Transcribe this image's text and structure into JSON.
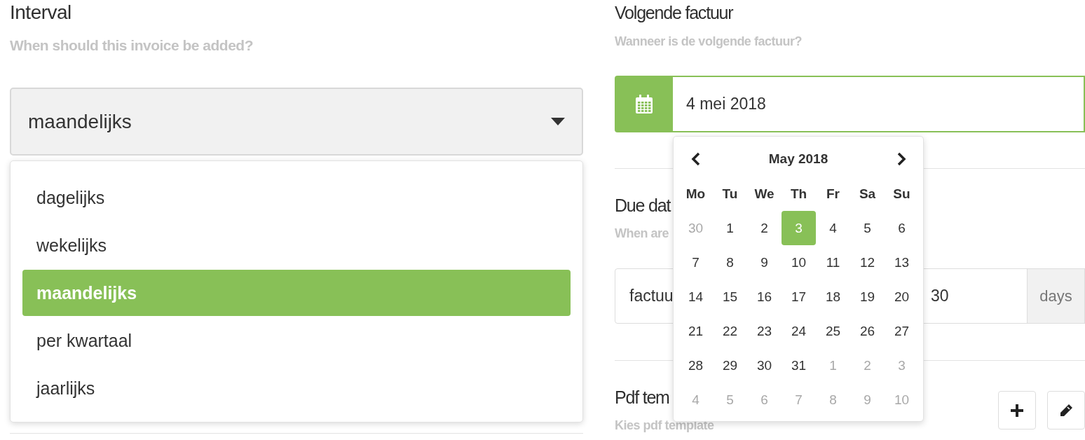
{
  "interval": {
    "title": "Interval",
    "subtitle": "When should this invoice be added?",
    "value": "maandelijks",
    "options": [
      {
        "label": "dagelijks",
        "selected": false
      },
      {
        "label": "wekelijks",
        "selected": false
      },
      {
        "label": "maandelijks",
        "selected": true
      },
      {
        "label": "per kwartaal",
        "selected": false
      },
      {
        "label": "jaarlijks",
        "selected": false
      }
    ]
  },
  "next_invoice": {
    "title": "Volgende factuur",
    "subtitle": "Wanneer is de volgende factuur?",
    "value": "4 mei 2018"
  },
  "due_date": {
    "title": "Due dat",
    "subtitle": "When are",
    "basis": "factuu",
    "amount": "30",
    "unit": "days"
  },
  "pdf_template": {
    "title": "Pdf tem",
    "subtitle": "Kies pdf template"
  },
  "calendar": {
    "title": "May 2018",
    "weekdays": [
      "Mo",
      "Tu",
      "We",
      "Th",
      "Fr",
      "Sa",
      "Su"
    ],
    "weeks": [
      [
        {
          "label": "30",
          "muted": true,
          "selected": false
        },
        {
          "label": "1",
          "muted": false,
          "selected": false
        },
        {
          "label": "2",
          "muted": false,
          "selected": false
        },
        {
          "label": "3",
          "muted": false,
          "selected": true
        },
        {
          "label": "4",
          "muted": false,
          "selected": false
        },
        {
          "label": "5",
          "muted": false,
          "selected": false
        },
        {
          "label": "6",
          "muted": false,
          "selected": false
        }
      ],
      [
        {
          "label": "7",
          "muted": false,
          "selected": false
        },
        {
          "label": "8",
          "muted": false,
          "selected": false
        },
        {
          "label": "9",
          "muted": false,
          "selected": false
        },
        {
          "label": "10",
          "muted": false,
          "selected": false
        },
        {
          "label": "11",
          "muted": false,
          "selected": false
        },
        {
          "label": "12",
          "muted": false,
          "selected": false
        },
        {
          "label": "13",
          "muted": false,
          "selected": false
        }
      ],
      [
        {
          "label": "14",
          "muted": false,
          "selected": false
        },
        {
          "label": "15",
          "muted": false,
          "selected": false
        },
        {
          "label": "16",
          "muted": false,
          "selected": false
        },
        {
          "label": "17",
          "muted": false,
          "selected": false
        },
        {
          "label": "18",
          "muted": false,
          "selected": false
        },
        {
          "label": "19",
          "muted": false,
          "selected": false
        },
        {
          "label": "20",
          "muted": false,
          "selected": false
        }
      ],
      [
        {
          "label": "21",
          "muted": false,
          "selected": false
        },
        {
          "label": "22",
          "muted": false,
          "selected": false
        },
        {
          "label": "23",
          "muted": false,
          "selected": false
        },
        {
          "label": "24",
          "muted": false,
          "selected": false
        },
        {
          "label": "25",
          "muted": false,
          "selected": false
        },
        {
          "label": "26",
          "muted": false,
          "selected": false
        },
        {
          "label": "27",
          "muted": false,
          "selected": false
        }
      ],
      [
        {
          "label": "28",
          "muted": false,
          "selected": false
        },
        {
          "label": "29",
          "muted": false,
          "selected": false
        },
        {
          "label": "30",
          "muted": false,
          "selected": false
        },
        {
          "label": "31",
          "muted": false,
          "selected": false
        },
        {
          "label": "1",
          "muted": true,
          "selected": false
        },
        {
          "label": "2",
          "muted": true,
          "selected": false
        },
        {
          "label": "3",
          "muted": true,
          "selected": false
        }
      ],
      [
        {
          "label": "4",
          "muted": true,
          "selected": false
        },
        {
          "label": "5",
          "muted": true,
          "selected": false
        },
        {
          "label": "6",
          "muted": true,
          "selected": false
        },
        {
          "label": "7",
          "muted": true,
          "selected": false
        },
        {
          "label": "8",
          "muted": true,
          "selected": false
        },
        {
          "label": "9",
          "muted": true,
          "selected": false
        },
        {
          "label": "10",
          "muted": true,
          "selected": false
        }
      ]
    ]
  }
}
